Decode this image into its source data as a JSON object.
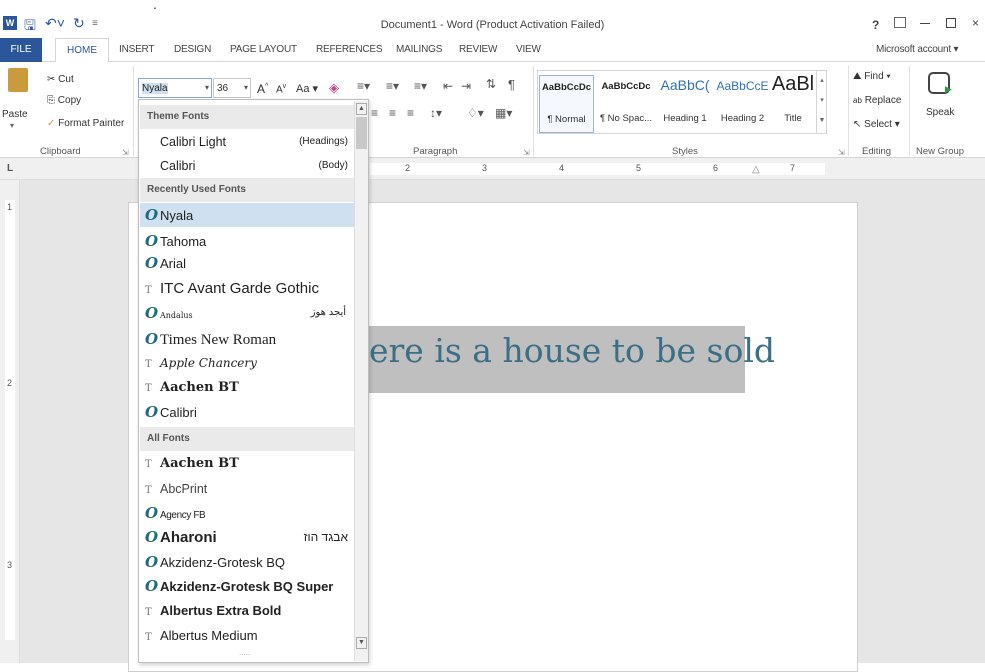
{
  "titlebar": {
    "title": "Document1 - Word (Product Activation Failed)",
    "help": "?",
    "dot": "."
  },
  "tabs": {
    "file": "FILE",
    "home": "HOME",
    "insert": "INSERT",
    "design": "DESIGN",
    "page_layout": "PAGE LAYOUT",
    "references": "REFERENCES",
    "mailings": "MAILINGS",
    "review": "REVIEW",
    "view": "VIEW",
    "account": "Microsoft account"
  },
  "clipboard": {
    "paste": "Paste",
    "cut": "Cut",
    "copy": "Copy",
    "format_painter": "Format Painter",
    "label": "Clipboard"
  },
  "font": {
    "name": "Nyala",
    "size": "36",
    "grow": "A",
    "shrink": "A",
    "case": "Aa"
  },
  "paragraph": {
    "label": "Paragraph"
  },
  "styles": {
    "label": "Styles",
    "items": [
      {
        "sample": "AaBbCcDc",
        "name": "¶ Normal"
      },
      {
        "sample": "AaBbCcDc",
        "name": "¶ No Spac..."
      },
      {
        "sample": "AaBbC(",
        "name": "Heading 1"
      },
      {
        "sample": "AaBbCcE",
        "name": "Heading 2"
      },
      {
        "sample": "AaBl",
        "name": "Title"
      }
    ]
  },
  "editing": {
    "find": "Find",
    "replace": "Replace",
    "select": "Select",
    "label": "Editing"
  },
  "new_group": {
    "speak": "Speak",
    "label": "New Group"
  },
  "ruler": {
    "marks": [
      "2",
      "3",
      "4",
      "5",
      "6",
      "7"
    ],
    "left_marks": [
      "1",
      "2",
      "3"
    ],
    "tab_selector": "L"
  },
  "document": {
    "text": "ere is a house to be sold"
  },
  "font_dropdown": {
    "theme_header": "Theme Fonts",
    "theme_fonts": [
      {
        "name": "Calibri Light",
        "role": "(Headings)"
      },
      {
        "name": "Calibri",
        "role": "(Body)"
      }
    ],
    "recent_header": "Recently Used Fonts",
    "recent_fonts": [
      {
        "name": "Nyala",
        "icon": "O"
      },
      {
        "name": "Tahoma",
        "icon": "O"
      },
      {
        "name": "Arial",
        "icon": "O"
      },
      {
        "name": "ITC Avant Garde Gothic",
        "icon": "T"
      },
      {
        "name": "Andalus",
        "icon": "O",
        "sample": "أيجد هوز"
      },
      {
        "name": "Times New Roman",
        "icon": "O"
      },
      {
        "name": "Apple Chancery",
        "icon": "T"
      },
      {
        "name": "Aachen BT",
        "icon": "T"
      },
      {
        "name": "Calibri",
        "icon": "O"
      }
    ],
    "all_header": "All Fonts",
    "all_fonts": [
      {
        "name": "Aachen BT",
        "icon": "T"
      },
      {
        "name": "AbcPrint",
        "icon": "T"
      },
      {
        "name": "Agency FB",
        "icon": "O"
      },
      {
        "name": "Aharoni",
        "icon": "O",
        "sample": "אבגד הוז"
      },
      {
        "name": "Akzidenz-Grotesk BQ",
        "icon": "O"
      },
      {
        "name": "Akzidenz-Grotesk BQ Super",
        "icon": "O"
      },
      {
        "name": "Albertus Extra Bold",
        "icon": "T"
      },
      {
        "name": "Albertus Medium",
        "icon": "T"
      }
    ],
    "dots": "....."
  },
  "colors": {
    "word_blue": "#2b579a",
    "doc_text": "#3b6f86",
    "highlight": "#bfbfbf",
    "selected_font": "#cfe0f1"
  }
}
